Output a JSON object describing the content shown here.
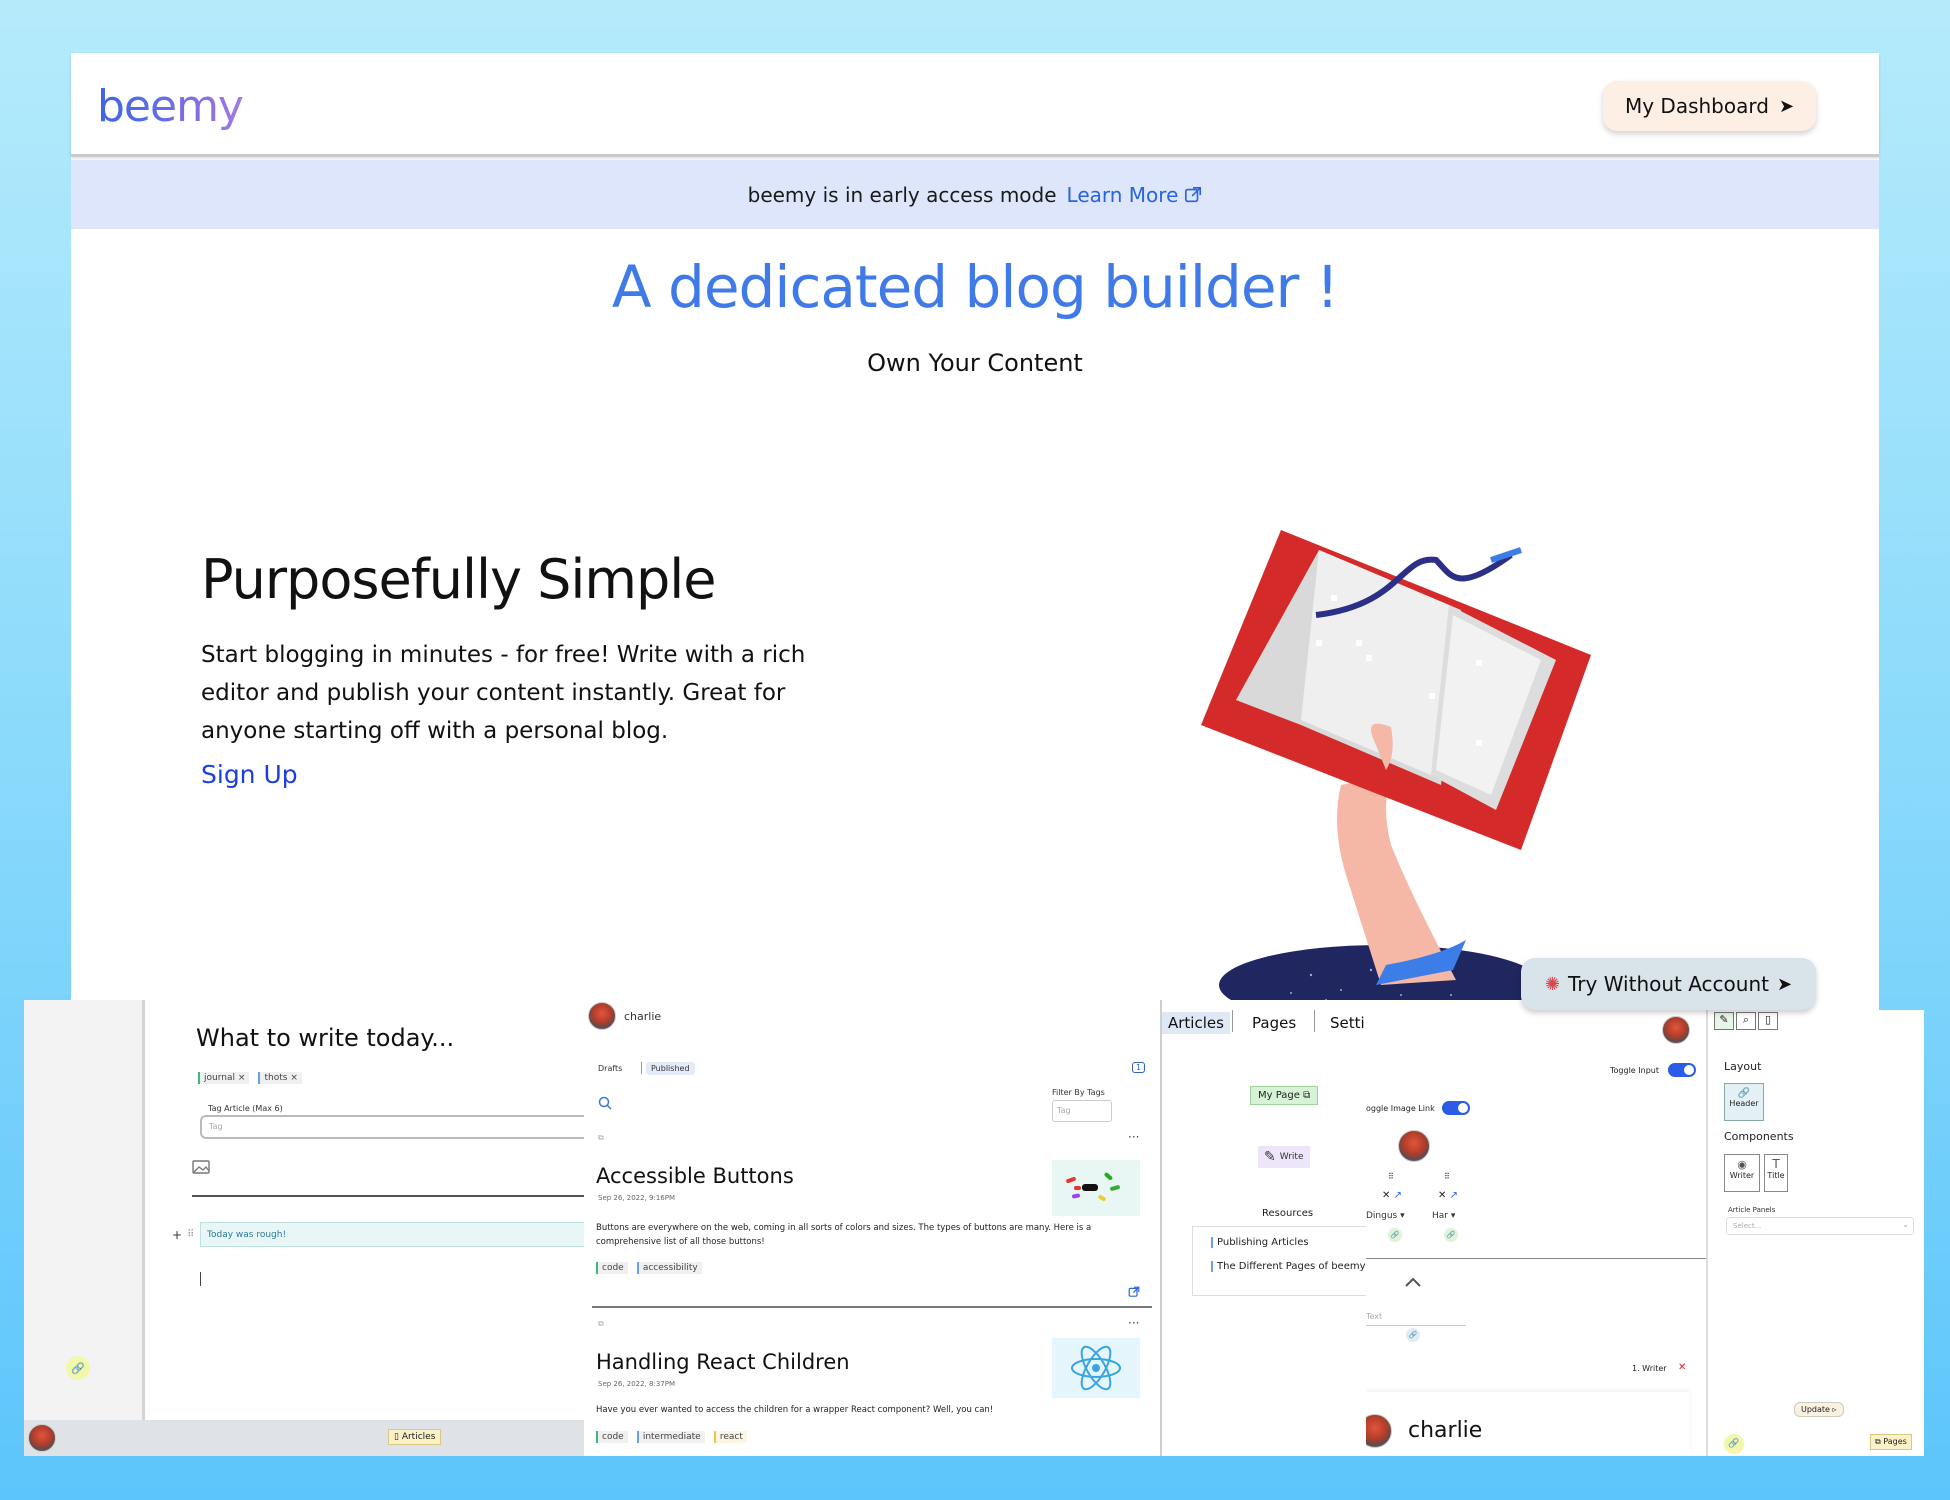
{
  "header": {
    "logo": "beemy",
    "dashboard_button": "My Dashboard"
  },
  "banner": {
    "text": "beemy is in early access mode",
    "link": "Learn More"
  },
  "hero": {
    "title": "A dedicated blog builder !",
    "subtitle": "Own Your Content"
  },
  "feature": {
    "title": "Purposefully Simple",
    "body": "Start blogging in minutes - for free! Write with a rich editor and publish your content instantly. Great for anyone starting off with a personal blog.",
    "cta": "Sign Up"
  },
  "try_button": "Try Without Account",
  "editor": {
    "heading": "What to write today...",
    "tags": [
      "journal",
      "thots"
    ],
    "tag_label": "Tag Article (Max 6)",
    "tag_placeholder": "Tag",
    "note": "Today was rough!",
    "footer_label": "Articles"
  },
  "articles_list": {
    "username": "charlie",
    "tab_drafts": "Drafts",
    "tab_published": "Published",
    "count": "1",
    "filter_label": "Filter By Tags",
    "filter_placeholder": "Tag",
    "items": [
      {
        "title": "Accessible Buttons",
        "date": "Sep 26, 2022, 9:16PM",
        "excerpt": "Buttons are everywhere on the web, coming in all sorts of colors and sizes. The types of buttons are many. Here is a comprehensive list of all those buttons!",
        "tags": [
          "code",
          "accessibility"
        ]
      },
      {
        "title": "Handling React Children",
        "date": "Sep 26, 2022, 8:37PM",
        "excerpt": "Have you ever wanted to access the children for a wrapper React component? Well, you can!",
        "tags": [
          "code",
          "intermediate",
          "react"
        ]
      }
    ]
  },
  "nav_panel": {
    "tabs": [
      "Articles",
      "Pages",
      "Setti"
    ],
    "my_page": "My Page",
    "write": "Write",
    "resources_label": "Resources",
    "resources": [
      "Publishing Articles",
      "The Different Pages of beemy"
    ]
  },
  "page_builder": {
    "toggle_input": "Toggle Input",
    "toggle_image_link": "oggle Image Link",
    "writer_a": "Dingus",
    "writer_b": "Har",
    "text_label": "Text",
    "writer_item": "1. Writer",
    "name": "charlie"
  },
  "layout_panel": {
    "layout_label": "Layout",
    "header_block": "Header",
    "components_label": "Components",
    "components": [
      "Writer",
      "Title"
    ],
    "article_panels_label": "Article Panels",
    "select_placeholder": "Select...",
    "update_button": "Update",
    "pages_label": "Pages"
  },
  "colors": {
    "brand_blue": "#3f7ae8",
    "link_blue": "#1b3fe0",
    "banner_bg": "#dde6fb",
    "dashboard_bg": "#fdefe3",
    "book_red": "#d42a2a",
    "toggle_blue": "#2b5ce8"
  }
}
